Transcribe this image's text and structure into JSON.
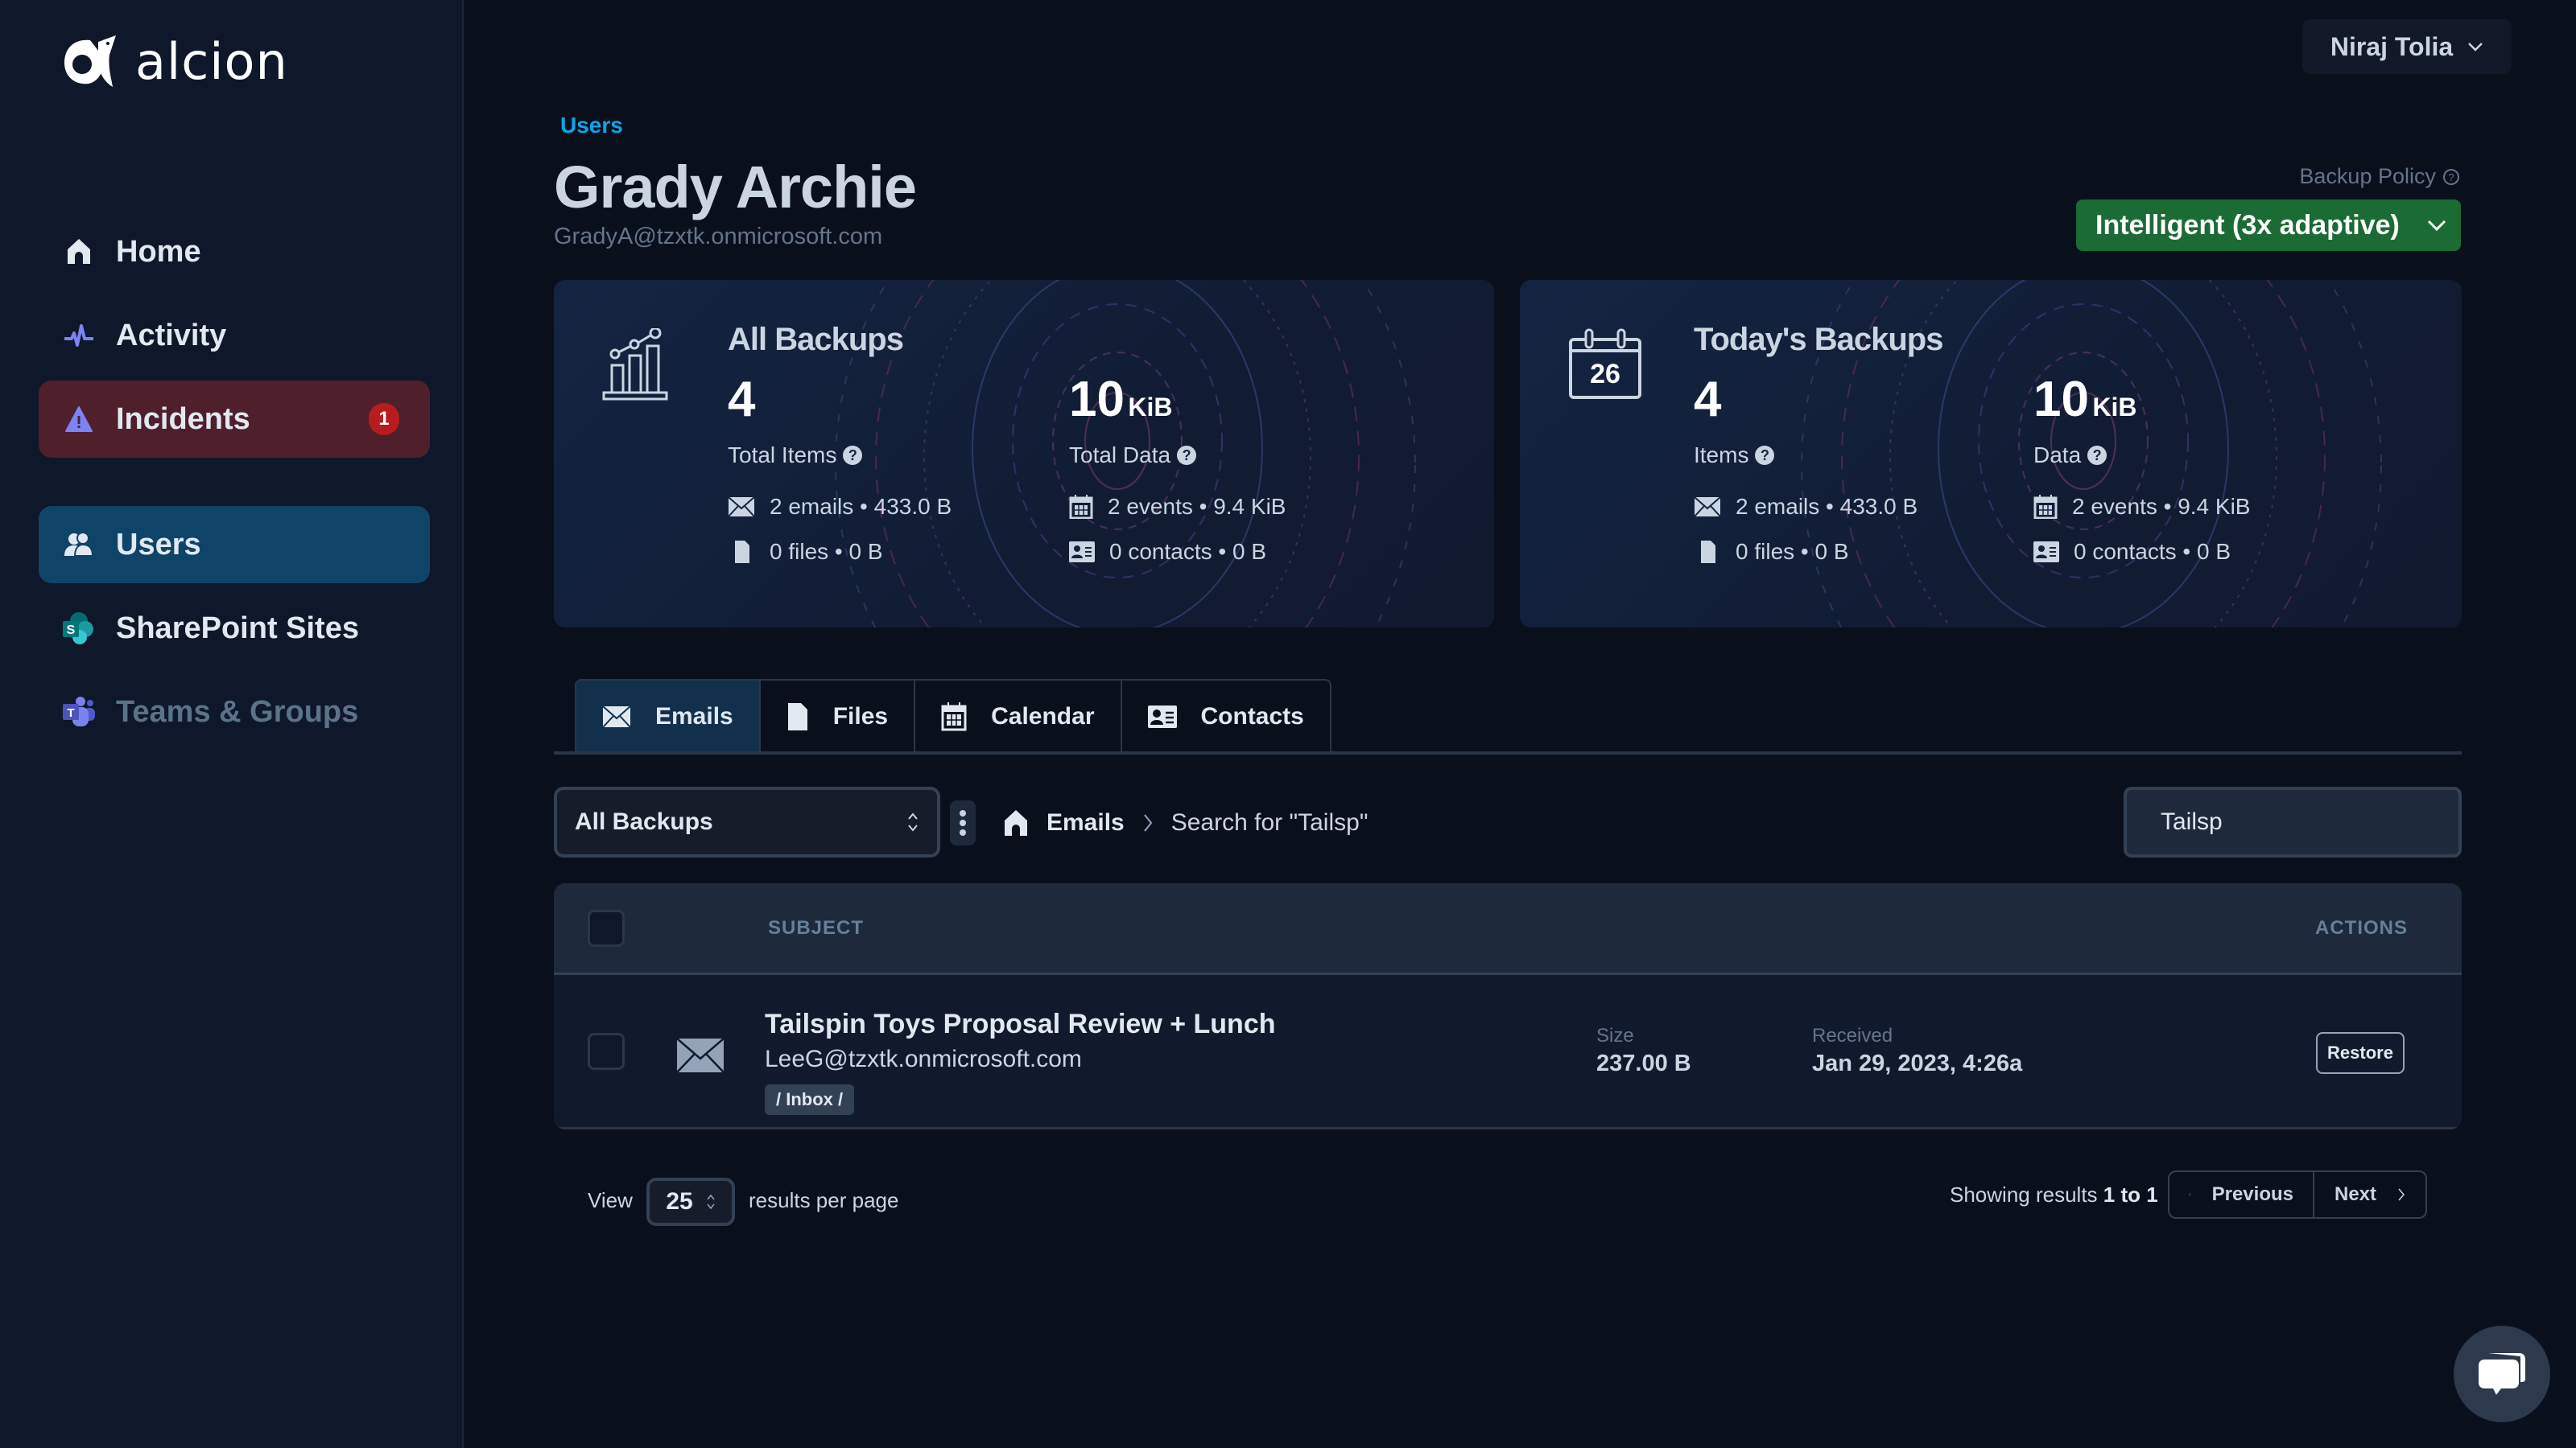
{
  "app": {
    "brand": "alcion"
  },
  "sidebar": {
    "items": [
      {
        "label": "Home",
        "icon": "home-icon"
      },
      {
        "label": "Activity",
        "icon": "activity-icon"
      },
      {
        "label": "Incidents",
        "icon": "warning-icon",
        "badge": "1"
      },
      {
        "label": "Users",
        "icon": "users-icon",
        "active": true
      },
      {
        "label": "SharePoint Sites",
        "icon": "sharepoint-icon"
      },
      {
        "label": "Teams & Groups",
        "icon": "teams-icon",
        "disabled": true
      }
    ]
  },
  "header": {
    "user_menu": "Niraj Tolia",
    "breadcrumb": "Users",
    "title": "Grady Archie",
    "subtitle": "GradyA@tzxtk.onmicrosoft.com",
    "backup_policy_label": "Backup Policy",
    "backup_policy_value": "Intelligent (3x adaptive)"
  },
  "cards": {
    "all": {
      "title": "All Backups",
      "items_value": "4",
      "items_label": "Total Items",
      "data_value": "10",
      "data_unit": "KiB",
      "data_label": "Total Data",
      "emails": "2 emails • 433.0 B",
      "files": "0 files • 0 B",
      "events": "2 events • 9.4 KiB",
      "contacts": "0 contacts • 0 B"
    },
    "today": {
      "title": "Today's Backups",
      "calendar_day": "26",
      "items_value": "4",
      "items_label": "Items",
      "data_value": "10",
      "data_unit": "KiB",
      "data_label": "Data",
      "emails": "2 emails • 433.0 B",
      "files": "0 files • 0 B",
      "events": "2 events • 9.4 KiB",
      "contacts": "0 contacts • 0 B"
    }
  },
  "tabs": [
    {
      "label": "Emails",
      "active": true
    },
    {
      "label": "Files"
    },
    {
      "label": "Calendar"
    },
    {
      "label": "Contacts"
    }
  ],
  "toolbar": {
    "backup_select": "All Backups",
    "crumb_root": "Emails",
    "crumb_current": "Search for \"Tailsp\"",
    "search_value": "Tailsp"
  },
  "table": {
    "columns": {
      "subject": "SUBJECT",
      "actions": "ACTIONS"
    },
    "rows": [
      {
        "subject": "Tailspin Toys Proposal Review + Lunch",
        "sender": "LeeG@tzxtk.onmicrosoft.com",
        "folder": "/ Inbox /",
        "size_label": "Size",
        "size": "237.00 B",
        "received_label": "Received",
        "received": "Jan 29, 2023, 4:26a",
        "action": "Restore"
      }
    ]
  },
  "pagination": {
    "view_label": "View",
    "page_size": "25",
    "per_page_label": "results per page",
    "showing_prefix": "Showing results",
    "showing_range": "1 to 1",
    "previous": "Previous",
    "next": "Next"
  }
}
